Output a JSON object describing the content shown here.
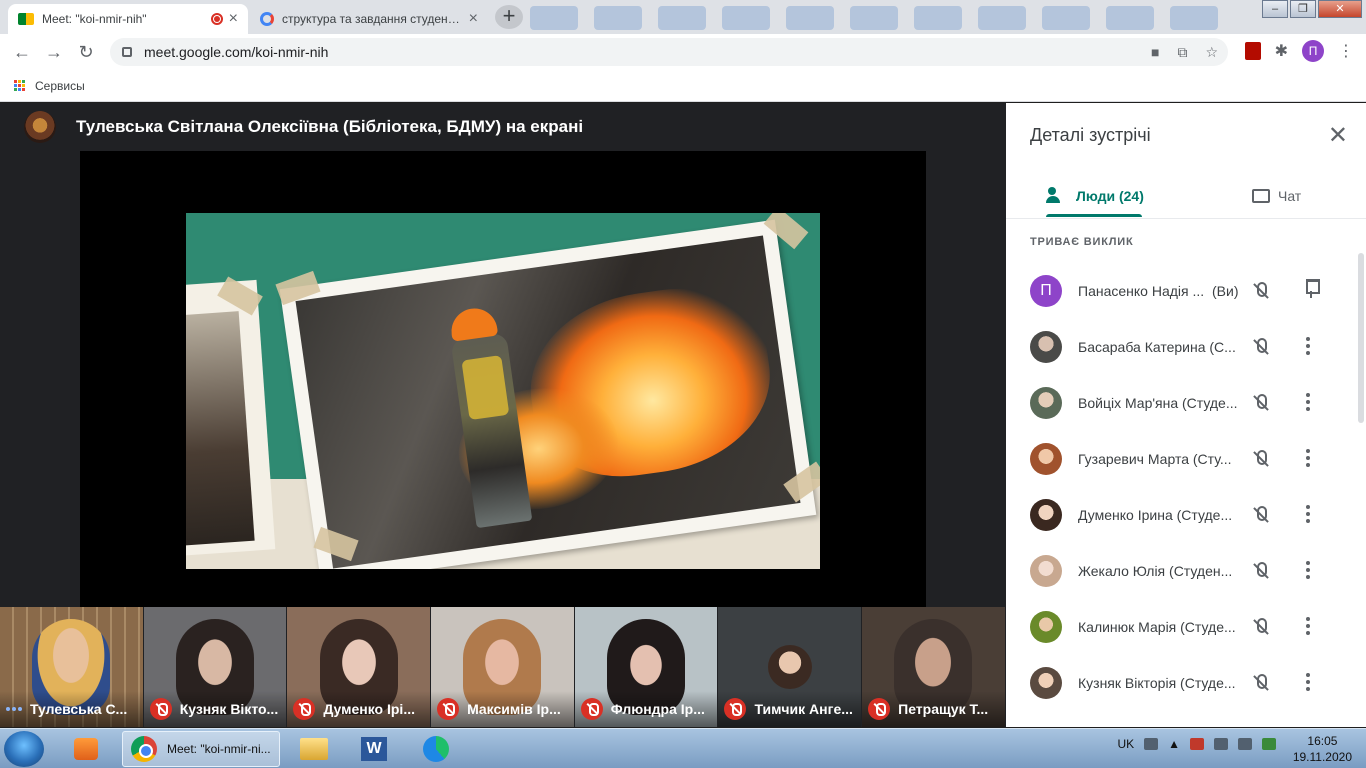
{
  "browser": {
    "tabs": [
      {
        "title": "Meet: \"koi-nmir-nih\"",
        "active": true
      },
      {
        "title": "структура та завдання студентсько",
        "active": false
      }
    ],
    "url": "meet.google.com/koi-nmir-nih",
    "bookmarks": [
      {
        "label": "Сервисы"
      }
    ],
    "profile_initial": "П"
  },
  "meet": {
    "presenter_banner": "Тулевська Світлана Олексіївна (Бібліотека, БДМУ) на екрані",
    "thumbnails": [
      {
        "name": "Тулевська С...",
        "muted": false
      },
      {
        "name": "Кузняк Вікто...",
        "muted": true
      },
      {
        "name": "Думенко Ірі...",
        "muted": true
      },
      {
        "name": "Максимів Ір...",
        "muted": true
      },
      {
        "name": "Флюндра Ір...",
        "muted": true
      },
      {
        "name": "Тимчик Анге...",
        "muted": true
      },
      {
        "name": "Петращук Т...",
        "muted": true
      }
    ]
  },
  "panel": {
    "title": "Деталі зустрічі",
    "tabs": {
      "people": "Люди (24)",
      "chat": "Чат"
    },
    "section": "ТРИВАЄ ВИКЛИК",
    "you_label": "(Ви)",
    "participants": [
      {
        "name": "Панасенко Надія ...",
        "initial": "П",
        "you": true
      },
      {
        "name": "Басараба Катерина (С..."
      },
      {
        "name": "Войціх Мар'яна (Студе..."
      },
      {
        "name": "Гузаревич Марта (Сту..."
      },
      {
        "name": "Думенко Ірина (Студе..."
      },
      {
        "name": "Жекало Юлія (Студен..."
      },
      {
        "name": "Калинюк Марія (Студе..."
      },
      {
        "name": "Кузняк Вікторія (Студе..."
      }
    ]
  },
  "taskbar": {
    "active_window": "Meet: \"koi-nmir-ni...",
    "language": "UK",
    "time": "16:05",
    "date": "19.11.2020"
  }
}
